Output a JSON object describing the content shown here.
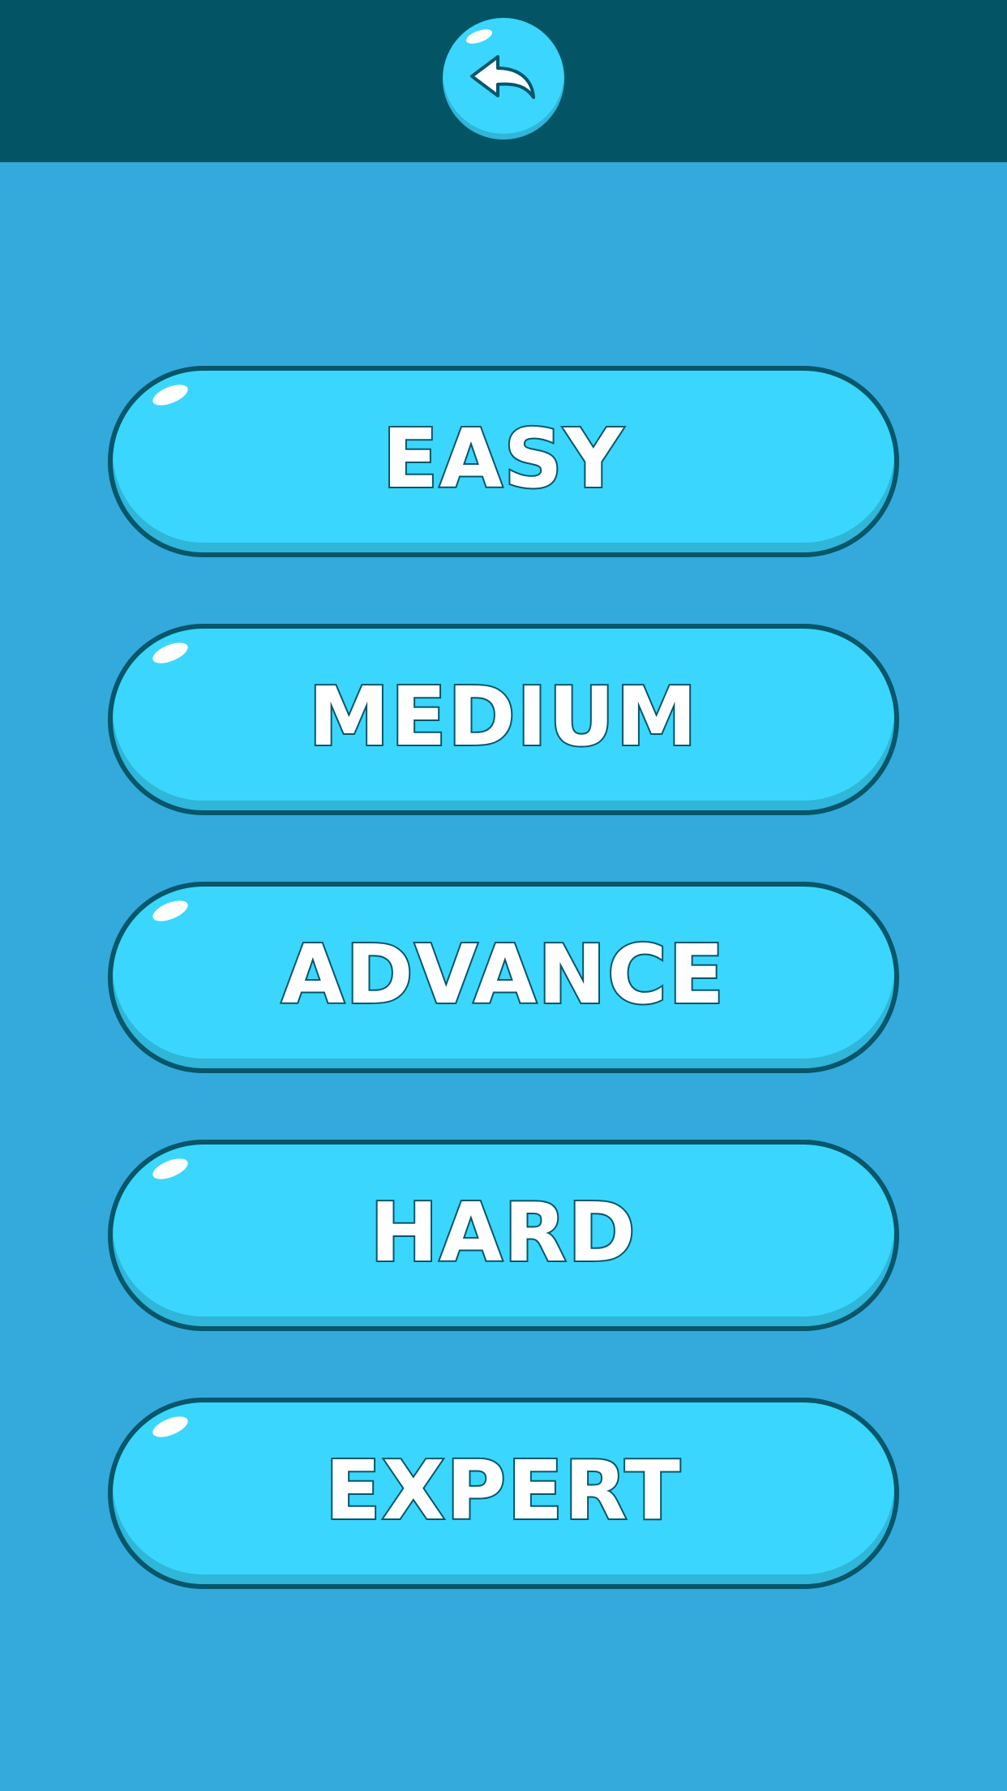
{
  "header": {
    "back_icon": "back-arrow-icon",
    "color": "#035566"
  },
  "colors": {
    "background": "#33aadb",
    "button": "#3ad6fd",
    "outline": "#07566a"
  },
  "levels": [
    {
      "label": "EASY"
    },
    {
      "label": "MEDIUM"
    },
    {
      "label": "ADVANCE"
    },
    {
      "label": "HARD"
    },
    {
      "label": "EXPERT"
    }
  ]
}
